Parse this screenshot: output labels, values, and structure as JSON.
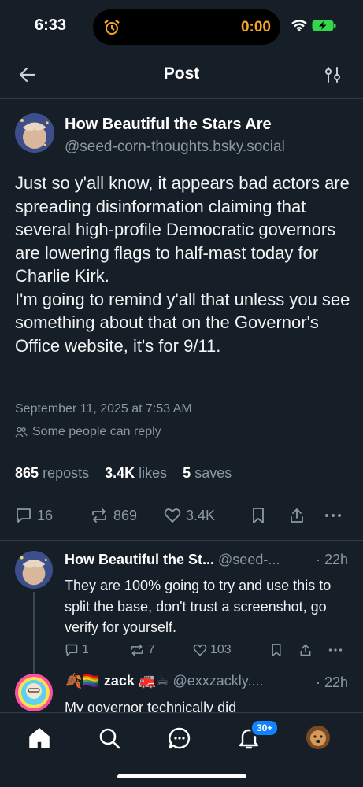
{
  "status": {
    "time": "6:33",
    "timer": "0:00"
  },
  "header": {
    "title": "Post"
  },
  "post": {
    "author_name": "How Beautiful the Stars Are",
    "author_handle": "@seed-corn-thoughts.bsky.social",
    "body": "Just so y'all know, it appears bad actors are spreading disinformation claiming that several high-profile Democratic governors are lowering flags to half-mast today for Charlie Kirk.\nI'm going to remind y'all that unless you see something about that on the Governor's Office website, it's for 9/11.",
    "date": "September 11, 2025 at 7:53 AM",
    "reply_setting": "Some people can reply",
    "stats": {
      "reposts_count": "865",
      "reposts_label": "reposts",
      "likes_count": "3.4K",
      "likes_label": "likes",
      "saves_count": "5",
      "saves_label": "saves"
    },
    "actions": {
      "replies": "16",
      "reposts": "869",
      "likes": "3.4K"
    }
  },
  "replies": [
    {
      "author_name": "How Beautiful the St...",
      "author_handle": "@seed-...",
      "time": "· 22h",
      "body": "They are 100% going to try and use this to split the base, don't trust a screenshot, go verify for yourself.",
      "replies": "1",
      "reposts": "7",
      "likes": "103"
    },
    {
      "author_prefix": "🍂🏳️‍🌈",
      "author_name": "zack",
      "author_suffix": "🚒☕",
      "author_handle": "@exxzackly....",
      "time": "· 22h",
      "body": "My governor technically did"
    }
  ],
  "tabbar": {
    "notifications_badge": "30+"
  },
  "colors": {
    "background": "#161e27",
    "accent": "#1083fe",
    "muted": "#8b98a6",
    "timer": "#f5a623"
  }
}
